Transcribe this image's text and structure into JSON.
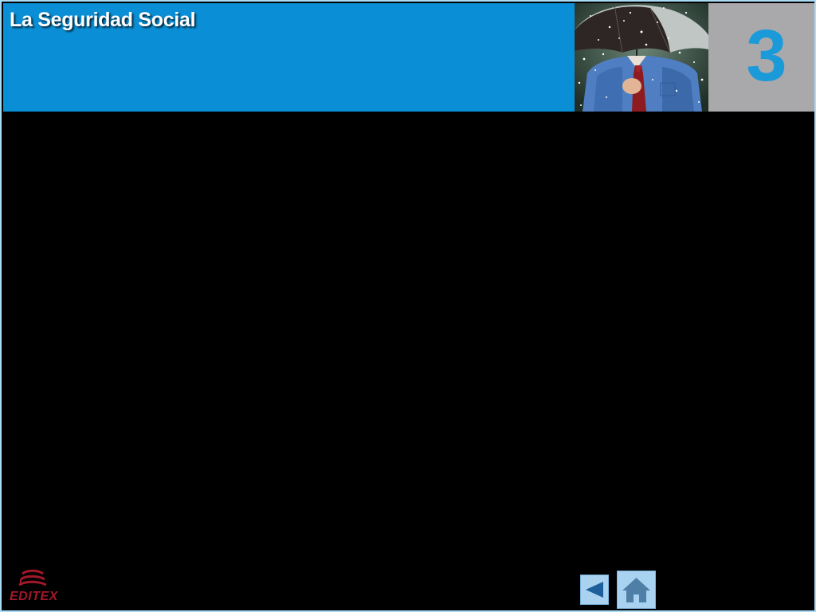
{
  "header": {
    "title": "La Seguridad Social",
    "unit_number": "3",
    "title_bg_color": "#0a8fd6",
    "unit_bg_color": "#a9a9ab",
    "unit_number_color": "#1a9ad8",
    "photo_icon": "man-with-umbrella-photo"
  },
  "footer": {
    "logo_text": "EDITEX",
    "logo_color": "#a0182a",
    "nav": {
      "back_icon": "triangle-left-icon",
      "home_icon": "house-icon",
      "button_color": "#a8d2ef"
    }
  }
}
